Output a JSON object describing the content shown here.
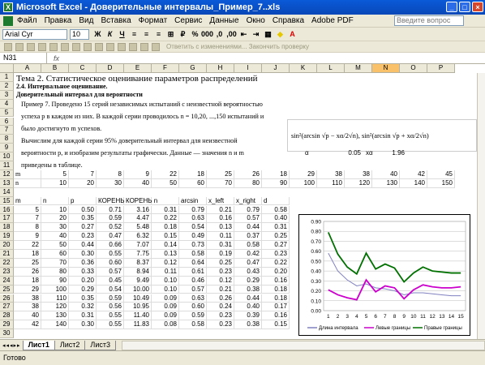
{
  "window": {
    "title": "Microsoft Excel - Доверительные интервалы_Пример_7..xls",
    "app_icon": "X"
  },
  "menu": {
    "items": [
      "Файл",
      "Правка",
      "Вид",
      "Вставка",
      "Формат",
      "Сервис",
      "Данные",
      "Окно",
      "Справка",
      "Adobe PDF"
    ],
    "question": "Введите вопрос"
  },
  "toolbar": {
    "font": "Arial Cyr",
    "size": "10",
    "bold": "Ж",
    "italic": "К",
    "underline": "Ч",
    "review_text": "Ответить с изменениями... Закончить проверку"
  },
  "formula": {
    "cell": "N31",
    "fx": "fx",
    "value": ""
  },
  "columns": [
    "A",
    "B",
    "C",
    "D",
    "E",
    "F",
    "G",
    "H",
    "I",
    "J",
    "K",
    "L",
    "M",
    "N",
    "O",
    "P"
  ],
  "rows_labels": [
    "1",
    "2",
    "3",
    "4",
    "5",
    "6",
    "7",
    "8",
    "9",
    "10",
    "11",
    "12",
    "13",
    "14",
    "15",
    "16",
    "17",
    "18",
    "19",
    "20",
    "21",
    "22",
    "23",
    "24",
    "25",
    "26",
    "27",
    "28",
    "29",
    "30"
  ],
  "header": {
    "title": "Тема 2. Статистическое оценивание параметров распределений",
    "section": "2.4. Интервальное оценивание.",
    "subsection": "Доверительный интервал для вероятности"
  },
  "description": [
    "Пример 7. Проведено 15 серий независимых испытаний с неизвестной вероятностью",
    "успеха p в каждом из них. В каждой серии проводилось n = 10,20, ...,150 испытаний и",
    "было достигнуто m успехов.",
    "Вычислим для каждой серии 95% доверительный интервал для неизвестной",
    "вероятности p, и изобразим результаты графически. Данные — значения n и m",
    "приведены в таблице."
  ],
  "formula_text": "sin²(arcsin √p − xα/2√n),  sin²(arcsin √p + xα/2√n)",
  "params": {
    "alpha_label": "α",
    "alpha_value": "0.05",
    "x_label": "xα",
    "x_value": "1.96"
  },
  "m_row": {
    "label": "m",
    "values": [
      "5",
      "7",
      "8",
      "9",
      "22",
      "18",
      "25",
      "26",
      "18",
      "29",
      "38",
      "38",
      "40",
      "42",
      "45"
    ]
  },
  "n_row": {
    "label": "n",
    "values": [
      "10",
      "20",
      "30",
      "40",
      "50",
      "60",
      "70",
      "80",
      "90",
      "100",
      "110",
      "120",
      "130",
      "140",
      "150"
    ]
  },
  "table_headers": [
    "m",
    "n",
    "p",
    "КОРЕНЬ",
    "КОРЕНЬ n",
    "",
    "arcsin",
    "x_left",
    "x_right",
    "d"
  ],
  "table_rows": [
    [
      "5",
      "10",
      "0.50",
      "0.71",
      "3.16",
      "0.31",
      "0.79",
      "0.21",
      "0.79",
      "0.58"
    ],
    [
      "7",
      "20",
      "0.35",
      "0.59",
      "4.47",
      "0.22",
      "0.63",
      "0.16",
      "0.57",
      "0.40"
    ],
    [
      "8",
      "30",
      "0.27",
      "0.52",
      "5.48",
      "0.18",
      "0.54",
      "0.13",
      "0.44",
      "0.31"
    ],
    [
      "9",
      "40",
      "0.23",
      "0.47",
      "6.32",
      "0.15",
      "0.49",
      "0.11",
      "0.37",
      "0.25"
    ],
    [
      "22",
      "50",
      "0.44",
      "0.66",
      "7.07",
      "0.14",
      "0.73",
      "0.31",
      "0.58",
      "0.27"
    ],
    [
      "18",
      "60",
      "0.30",
      "0.55",
      "7.75",
      "0.13",
      "0.58",
      "0.19",
      "0.42",
      "0.23"
    ],
    [
      "25",
      "70",
      "0.36",
      "0.60",
      "8.37",
      "0.12",
      "0.64",
      "0.25",
      "0.47",
      "0.22"
    ],
    [
      "26",
      "80",
      "0.33",
      "0.57",
      "8.94",
      "0.11",
      "0.61",
      "0.23",
      "0.43",
      "0.20"
    ],
    [
      "18",
      "90",
      "0.20",
      "0.45",
      "9.49",
      "0.10",
      "0.46",
      "0.12",
      "0.29",
      "0.16"
    ],
    [
      "29",
      "100",
      "0.29",
      "0.54",
      "10.00",
      "0.10",
      "0.57",
      "0.21",
      "0.38",
      "0.18"
    ],
    [
      "38",
      "110",
      "0.35",
      "0.59",
      "10.49",
      "0.09",
      "0.63",
      "0.26",
      "0.44",
      "0.18"
    ],
    [
      "38",
      "120",
      "0.32",
      "0.56",
      "10.95",
      "0.09",
      "0.60",
      "0.24",
      "0.40",
      "0.17"
    ],
    [
      "40",
      "130",
      "0.31",
      "0.55",
      "11.40",
      "0.09",
      "0.59",
      "0.23",
      "0.39",
      "0.16"
    ],
    [
      "42",
      "140",
      "0.30",
      "0.55",
      "11.83",
      "0.08",
      "0.58",
      "0.23",
      "0.38",
      "0.15"
    ]
  ],
  "sheet_tabs": [
    "Лист1",
    "Лист2",
    "Лист3"
  ],
  "status": "Готово",
  "chart_data": {
    "type": "line",
    "x": [
      1,
      2,
      3,
      4,
      5,
      6,
      7,
      8,
      9,
      10,
      11,
      12,
      13,
      14,
      15
    ],
    "ylim": [
      0,
      0.9
    ],
    "yticks": [
      "0.00",
      "0.10",
      "0.20",
      "0.30",
      "0.40",
      "0.50",
      "0.60",
      "0.70",
      "0.80",
      "0.90"
    ],
    "series": [
      {
        "name": "Длина интервала",
        "color": "#8080c0",
        "values": [
          0.58,
          0.4,
          0.31,
          0.25,
          0.27,
          0.23,
          0.22,
          0.2,
          0.16,
          0.18,
          0.18,
          0.17,
          0.16,
          0.15,
          0.15
        ]
      },
      {
        "name": "Левые границы",
        "color": "#cc00cc",
        "values": [
          0.21,
          0.16,
          0.13,
          0.11,
          0.31,
          0.19,
          0.25,
          0.23,
          0.12,
          0.21,
          0.26,
          0.24,
          0.23,
          0.23,
          0.24
        ]
      },
      {
        "name": "Правые границы",
        "color": "#007000",
        "values": [
          0.79,
          0.57,
          0.44,
          0.37,
          0.58,
          0.42,
          0.47,
          0.43,
          0.29,
          0.38,
          0.44,
          0.4,
          0.39,
          0.38,
          0.38
        ]
      }
    ]
  }
}
